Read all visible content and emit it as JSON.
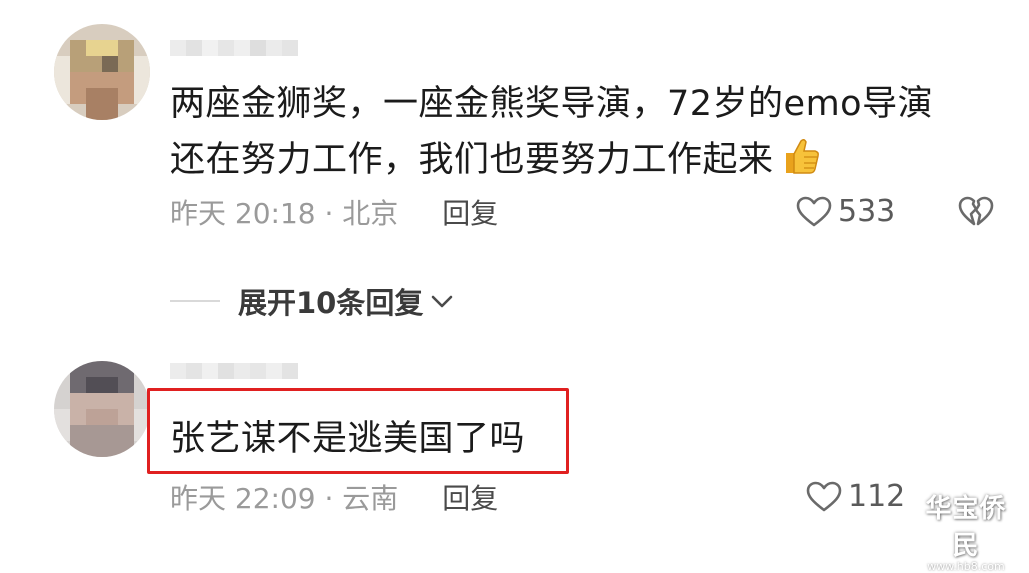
{
  "comments": [
    {
      "text_line1": "两座金狮奖，一座金熊奖导演，72岁的emo导演",
      "text_line2": "还在努力工作，我们也要努力工作起来",
      "emoji": "thumbs-up",
      "time_location": "昨天 20:18 · 北京",
      "reply_label": "回复",
      "likes": "533"
    },
    {
      "text": "张艺谋不是逃美国了吗",
      "time_location": "昨天 22:09 · 云南",
      "reply_label": "回复",
      "likes": "112"
    }
  ],
  "expand_replies": "展开10条回复",
  "watermark": {
    "main": "华宝侨民",
    "sub": "www.hb8.com"
  },
  "colors": {
    "highlight_border": "#e02020",
    "meta_text": "#9a9a9a",
    "body_text": "#1b1b1b"
  }
}
